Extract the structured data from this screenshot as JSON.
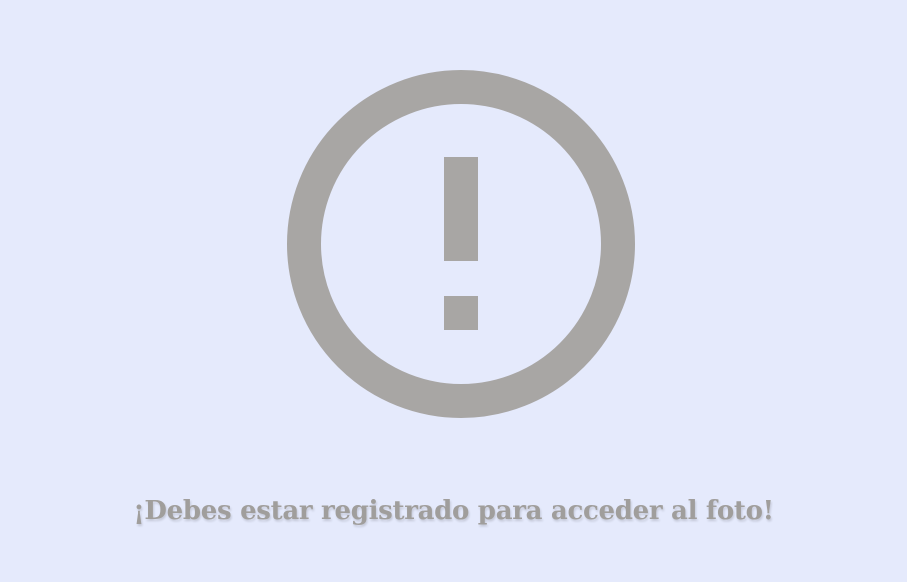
{
  "alert": {
    "icon": "exclamation-circle-icon",
    "icon_color": "#a8a6a4",
    "message": "¡Debes estar registrado para acceder al foto!"
  }
}
